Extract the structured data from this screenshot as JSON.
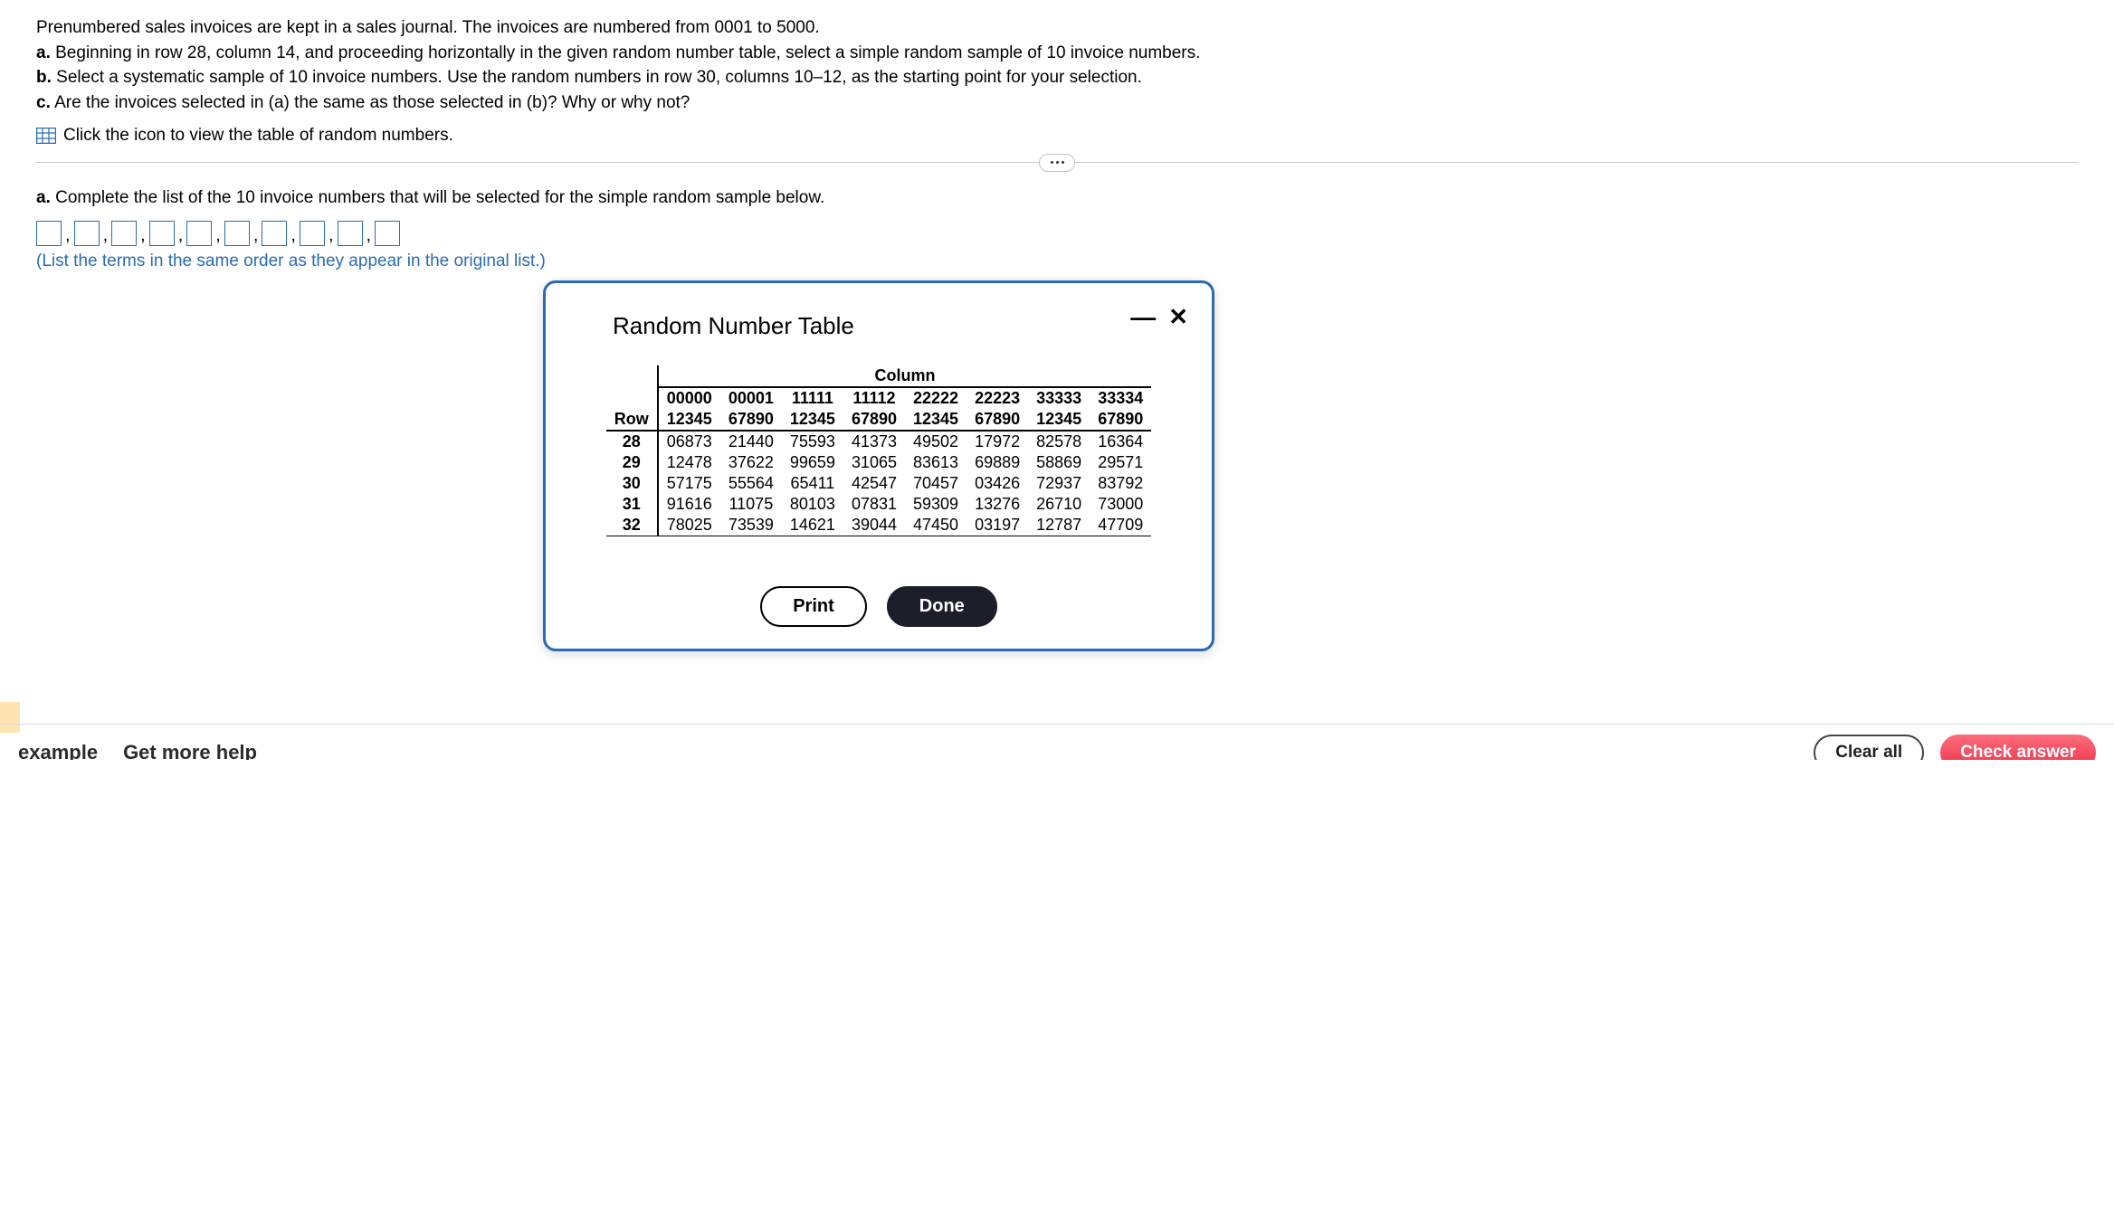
{
  "problem": {
    "intro": "Prenumbered sales invoices are kept in a sales journal. The invoices are numbered from 0001 to 5000.",
    "a_label": "a.",
    "a_text": " Beginning in row 28, column 14, and proceeding horizontally in the given random number table, select a simple random sample of 10 invoice numbers.",
    "b_label": "b.",
    "b_text": " Select a systematic sample of 10 invoice numbers. Use the random numbers in row 30, columns 10–12, as the starting point for your selection.",
    "c_label": "c.",
    "c_text": " Are the invoices selected in (a) the same as those selected in (b)? Why or why not?",
    "icon_link": "Click the icon to view the table of random numbers."
  },
  "question": {
    "a_label": "a.",
    "a_text": " Complete the list of the 10 invoice numbers that will be selected for the simple random sample below.",
    "instruction": "(List the terms in the same order as they appear in the original list.)"
  },
  "modal": {
    "title": "Random Number Table",
    "col_heading": "Column",
    "row_heading": "Row",
    "header1": [
      "00000",
      "00001",
      "11111",
      "11112",
      "22222",
      "22223",
      "33333",
      "33334"
    ],
    "header2": [
      "12345",
      "67890",
      "12345",
      "67890",
      "12345",
      "67890",
      "12345",
      "67890"
    ],
    "rows": [
      {
        "label": "28",
        "cells": [
          "06873",
          "21440",
          "75593",
          "41373",
          "49502",
          "17972",
          "82578",
          "16364"
        ]
      },
      {
        "label": "29",
        "cells": [
          "12478",
          "37622",
          "99659",
          "31065",
          "83613",
          "69889",
          "58869",
          "29571"
        ]
      },
      {
        "label": "30",
        "cells": [
          "57175",
          "55564",
          "65411",
          "42547",
          "70457",
          "03426",
          "72937",
          "83792"
        ]
      },
      {
        "label": "31",
        "cells": [
          "91616",
          "11075",
          "80103",
          "07831",
          "59309",
          "13276",
          "26710",
          "73000"
        ]
      },
      {
        "label": "32",
        "cells": [
          "78025",
          "73539",
          "14621",
          "39044",
          "47450",
          "03197",
          "12787",
          "47709"
        ]
      }
    ],
    "print": "Print",
    "done": "Done"
  },
  "footer": {
    "example": "example",
    "get_help": "Get more help",
    "clear": "Clear all",
    "check": "Check answer"
  }
}
